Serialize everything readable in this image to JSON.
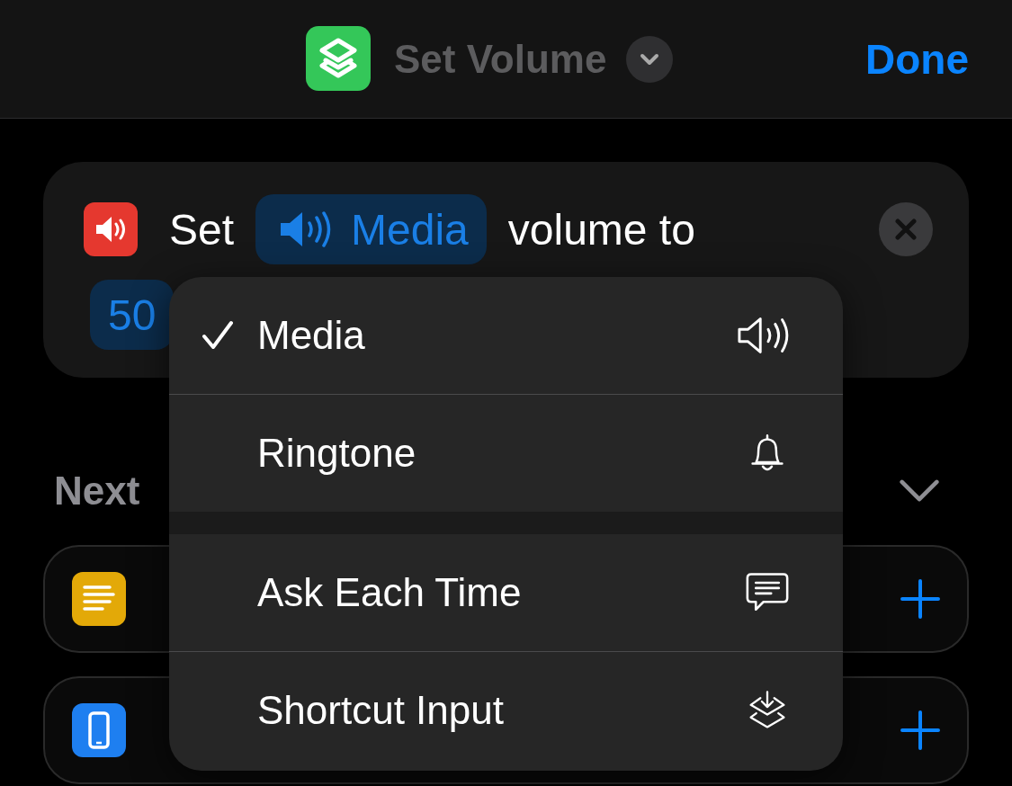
{
  "nav": {
    "title": "Set Volume",
    "done": "Done"
  },
  "action": {
    "verb": "Set",
    "parameter": "Media",
    "rest": "volume to",
    "value": "50"
  },
  "next_actions": {
    "heading": "Next",
    "items": [
      {
        "kind": "text"
      },
      {
        "kind": "device"
      }
    ]
  },
  "menu": {
    "sections": [
      [
        {
          "label": "Media",
          "selected": true,
          "kind": "speaker"
        },
        {
          "label": "Ringtone",
          "selected": false,
          "kind": "bell"
        }
      ],
      [
        {
          "label": "Ask Each Time",
          "selected": false,
          "kind": "chat"
        },
        {
          "label": "Shortcut Input",
          "selected": false,
          "kind": "layers"
        }
      ]
    ]
  }
}
